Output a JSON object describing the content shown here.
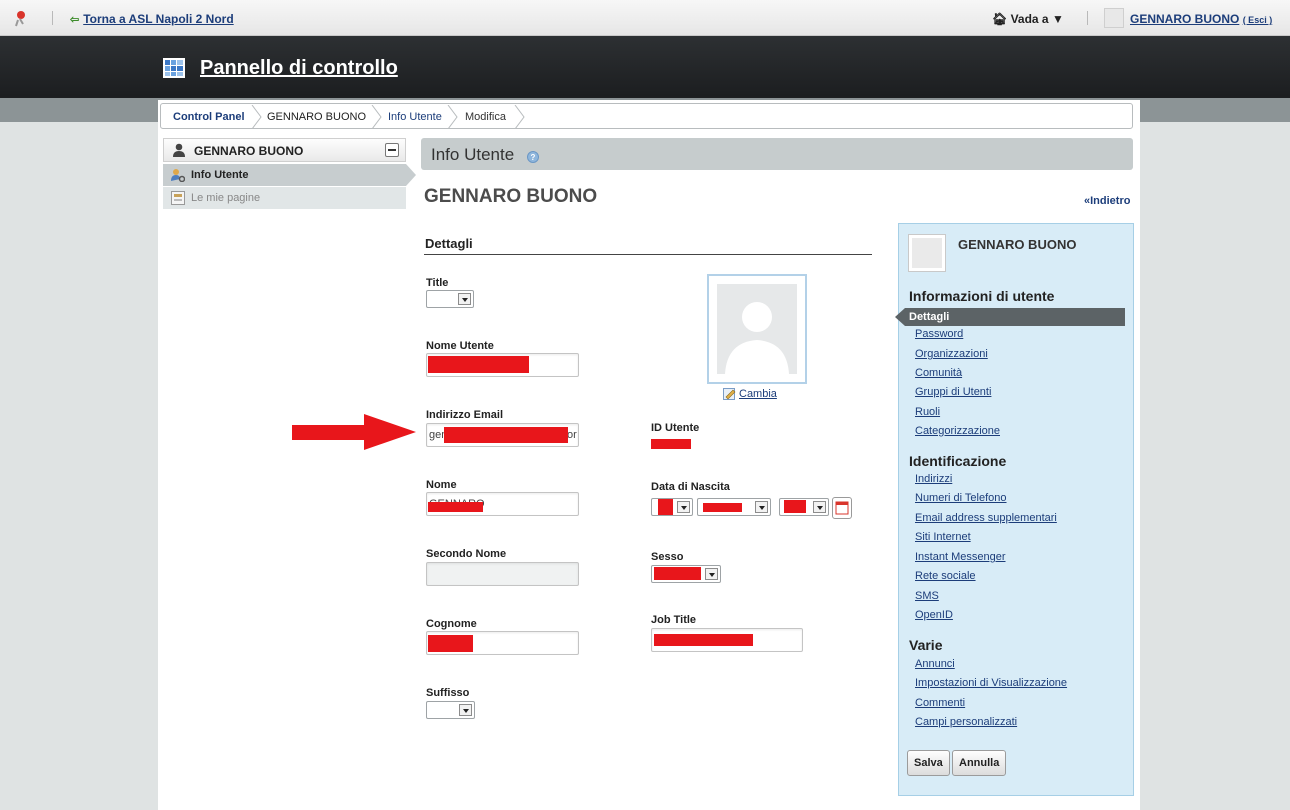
{
  "dockbar": {
    "back_link": "Torna a ASL Napoli 2 Nord",
    "goto_label": "Vada a ▼",
    "user_name": "GENNARO BUONO",
    "logout_label": "( Esci )"
  },
  "header": {
    "title": "Pannello di controllo"
  },
  "breadcrumb": [
    "Control Panel",
    "GENNARO BUONO",
    "Info Utente",
    "Modifica"
  ],
  "left_panel": {
    "user": "GENNARO BUONO",
    "items": [
      {
        "label": "Info Utente",
        "active": true
      },
      {
        "label": "Le mie pagine",
        "active": false
      }
    ]
  },
  "content": {
    "section_title": "Info Utente",
    "user_title": "GENNARO BUONO",
    "back_link": "«Indietro",
    "fieldset_title": "Dettagli",
    "fields": {
      "title_label": "Title",
      "screen_name_label": "Nome Utente",
      "email_label": "Indirizzo Email",
      "email_visible_start": "gen",
      "email_visible_end": "or",
      "first_name_label": "Nome",
      "first_name_value": "GENNARO",
      "middle_name_label": "Secondo Nome",
      "last_name_label": "Cognome",
      "suffix_label": "Suffisso",
      "user_id_label": "ID Utente",
      "birthday_label": "Data di Nascita",
      "gender_label": "Sesso",
      "job_title_label": "Job Title"
    },
    "change_photo": "Cambia"
  },
  "right_panel": {
    "user": "GENNARO BUONO",
    "groups": [
      {
        "title": "Informazioni di utente",
        "items": [
          "Dettagli",
          "Password",
          "Organizzazioni",
          "Comunità",
          "Gruppi di Utenti",
          "Ruoli",
          "Categorizzazione"
        ]
      },
      {
        "title": "Identificazione",
        "items": [
          "Indirizzi",
          "Numeri di Telefono",
          "Email address supplementari",
          "Siti Internet",
          "Instant Messenger",
          "Rete sociale",
          "SMS",
          "OpenID"
        ]
      },
      {
        "title": "Varie",
        "items": [
          "Annunci",
          "Impostazioni di Visualizzazione",
          "Commenti",
          "Campi personalizzati"
        ]
      }
    ],
    "save_label": "Salva",
    "cancel_label": "Annulla"
  },
  "colors": {
    "annotation_arrow": "#e8161b",
    "redaction": "#e8161b",
    "header_dark": "#1c1e20",
    "panel_blue": "#d8ecf7"
  }
}
